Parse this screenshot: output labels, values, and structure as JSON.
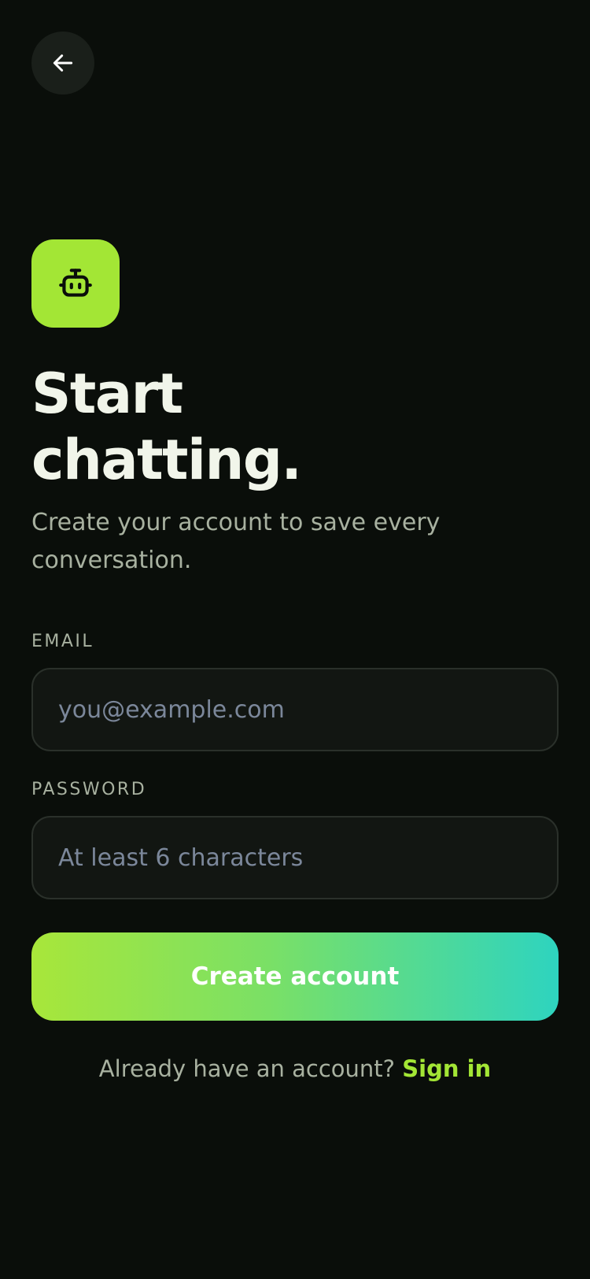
{
  "header": {
    "back_icon": "arrow-left-icon"
  },
  "brand": {
    "logo_icon": "robot-icon",
    "logo_bg": "#a3e635"
  },
  "hero": {
    "title_line1": "Start",
    "title_line2": "chatting.",
    "subtitle": "Create your account to save every conversation."
  },
  "form": {
    "email_label": "EMAIL",
    "email_value": "",
    "email_placeholder": "you@example.com",
    "password_label": "PASSWORD",
    "password_value": "",
    "password_placeholder": "At least 6 characters",
    "submit_label": "Create account"
  },
  "footer": {
    "prompt": "Already have an account?",
    "link_label": "Sign in"
  },
  "colors": {
    "background": "#0a0e0a",
    "accent": "#a3e635",
    "gradient_start": "#a8e63a",
    "gradient_end": "#2ed4bf",
    "muted_text": "#a8b1a0"
  }
}
